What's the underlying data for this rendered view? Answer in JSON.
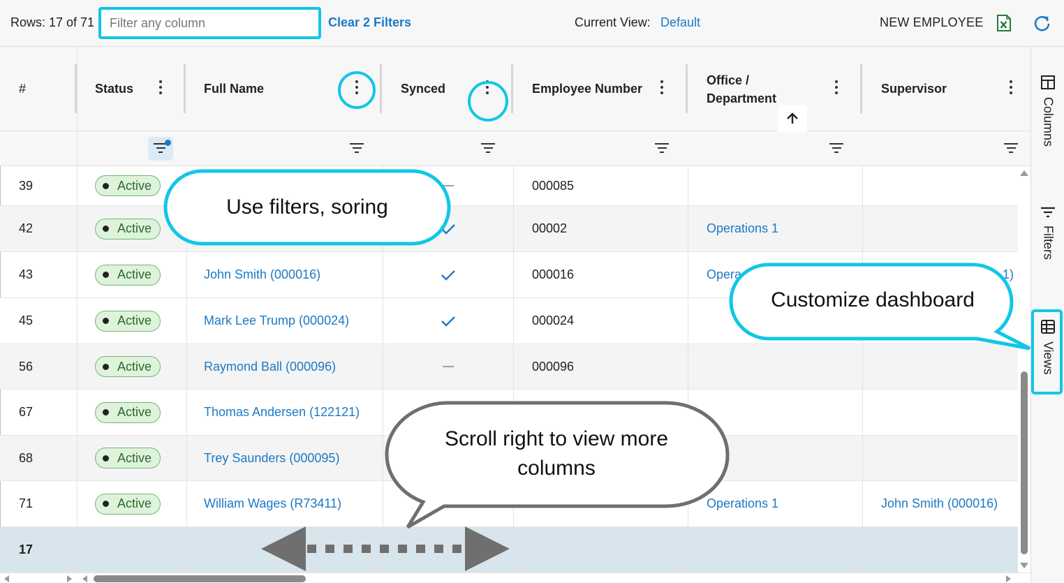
{
  "toolbar": {
    "rows_label": "Rows: 17 of 71",
    "filter_placeholder": "Filter any column",
    "clear_filters": "Clear 2 Filters",
    "current_view_label": "Current View:",
    "current_view_value": "Default",
    "new_employee": "NEW EMPLOYEE"
  },
  "columns": {
    "index": "#",
    "status": "Status",
    "full_name": "Full Name",
    "synced": "Synced",
    "employee_number": "Employee Number",
    "office_line1": "Office /",
    "office_line2": "Department",
    "supervisor": "Supervisor"
  },
  "rows": [
    {
      "index": "39",
      "status": "Active",
      "name": "",
      "synced": "dash",
      "employee_number": "000085",
      "office": "",
      "supervisor": ""
    },
    {
      "index": "42",
      "status": "Active",
      "name": "",
      "synced": "check",
      "employee_number": "00002",
      "office": "Operations 1",
      "supervisor": ""
    },
    {
      "index": "43",
      "status": "Active",
      "name": "John Smith (000016)",
      "synced": "check",
      "employee_number": "000016",
      "office": "Opera",
      "supervisor": "1)"
    },
    {
      "index": "45",
      "status": "Active",
      "name": "Mark Lee Trump (000024)",
      "synced": "check",
      "employee_number": "000024",
      "office": "",
      "supervisor": ""
    },
    {
      "index": "56",
      "status": "Active",
      "name": "Raymond Ball (000096)",
      "synced": "dash",
      "employee_number": "000096",
      "office": "",
      "supervisor": ""
    },
    {
      "index": "67",
      "status": "Active",
      "name": "Thomas Andersen (122121)",
      "synced": "",
      "employee_number": "",
      "office": "",
      "supervisor": ""
    },
    {
      "index": "68",
      "status": "Active",
      "name": "Trey Saunders (000095)",
      "synced": "",
      "employee_number": "",
      "office": "",
      "supervisor": ""
    },
    {
      "index": "71",
      "status": "Active",
      "name": "William Wages (R73411)",
      "synced": "",
      "employee_number": "",
      "office": "Operations 1",
      "supervisor": "John Smith (000016)"
    }
  ],
  "footer_total": "17",
  "side_panel": {
    "columns": "Columns",
    "filters": "Filters",
    "views": "Views"
  },
  "callouts": {
    "filters": "Use filters, soring",
    "dashboard": "Customize dashboard",
    "scroll": "Scroll right to view more columns"
  },
  "colors": {
    "accent": "#12c6e6",
    "link": "#1d79c4",
    "badge_bg": "#dff2dc",
    "badge_border": "#6dbb6d",
    "total_row_bg": "#d9e5ec",
    "excel_green": "#1e7b34"
  }
}
